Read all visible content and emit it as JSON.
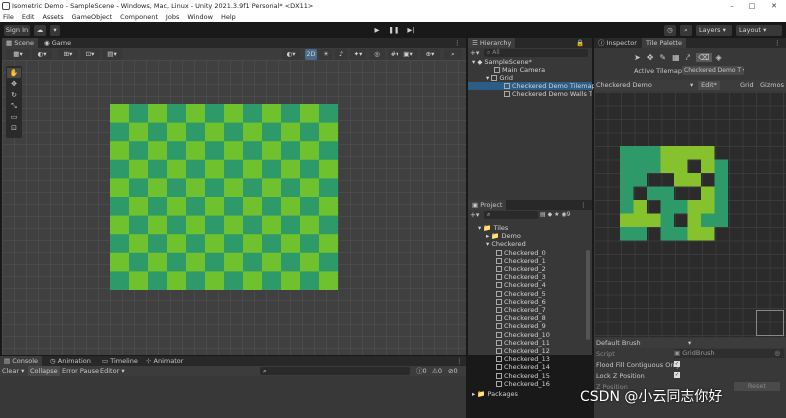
{
  "window": {
    "title": "Isometric Demo - SampleScene - Windows, Mac, Linux - Unity 2021.3.9f1 Personal* <DX11>"
  },
  "menu": [
    "File",
    "Edit",
    "Assets",
    "GameObject",
    "Component",
    "Jobs",
    "Window",
    "Help"
  ],
  "toolbar": {
    "signin": "Sign In",
    "layers": "Layers",
    "layout": "Layout"
  },
  "scene_tabs": {
    "scene": "Scene",
    "game": "Game"
  },
  "scene_toolbar": {
    "mode_2d": "2D"
  },
  "hierarchy": {
    "title": "Hierarchy",
    "search_placeholder": "All",
    "items": [
      {
        "label": "SampleScene*"
      },
      {
        "label": "Main Camera"
      },
      {
        "label": "Grid"
      },
      {
        "label": "Checkered Demo Tilemap"
      },
      {
        "label": "Checkered Demo Walls Til"
      }
    ]
  },
  "project": {
    "title": "Project",
    "count": "9",
    "items": [
      {
        "label": "Tiles"
      },
      {
        "label": "Demo"
      },
      {
        "label": "Checkered"
      },
      {
        "label": "Checkered_0"
      },
      {
        "label": "Checkered_1"
      },
      {
        "label": "Checkered_2"
      },
      {
        "label": "Checkered_3"
      },
      {
        "label": "Checkered_4"
      },
      {
        "label": "Checkered_5"
      },
      {
        "label": "Checkered_6"
      },
      {
        "label": "Checkered_7"
      },
      {
        "label": "Checkered_8"
      },
      {
        "label": "Checkered_9"
      },
      {
        "label": "Checkered_10"
      },
      {
        "label": "Checkered_11"
      },
      {
        "label": "Checkered_12"
      },
      {
        "label": "Checkered_13"
      },
      {
        "label": "Checkered_14"
      },
      {
        "label": "Checkered_15"
      },
      {
        "label": "Checkered_16"
      },
      {
        "label": "Packages"
      }
    ]
  },
  "inspector_tabs": {
    "inspector": "Inspector",
    "tile_palette": "Tile Palette"
  },
  "palette": {
    "active_tilemap_label": "Active Tilemap",
    "active_tilemap_value": "Checkered Demo T",
    "palette_name": "Checkered Demo",
    "edit": "Edit*",
    "grid": "Grid",
    "gizmos": "Gizmos",
    "brush": "Default Brush",
    "script_label": "Script",
    "script_value": "GridBrush",
    "flood_fill": "Flood Fill Contiguous Only",
    "lock_z": "Lock Z Position",
    "z_position": "Z Position",
    "reset": "Reset"
  },
  "console_tabs": {
    "console": "Console",
    "animation": "Animation",
    "timeline": "Timeline",
    "animator": "Animator"
  },
  "console_bar": {
    "clear": "Clear",
    "collapse": "Collapse",
    "error_pause": "Error Pause",
    "editor": "Editor",
    "info_count": "0",
    "warn_count": "0",
    "error_count": "0"
  },
  "watermark": "CSDN @小云同志你好",
  "colors": {
    "tile_light": "#6fc12d",
    "tile_dark": "#2f9a69",
    "scene_bg": "#404040",
    "accent": "#2c5d87"
  }
}
